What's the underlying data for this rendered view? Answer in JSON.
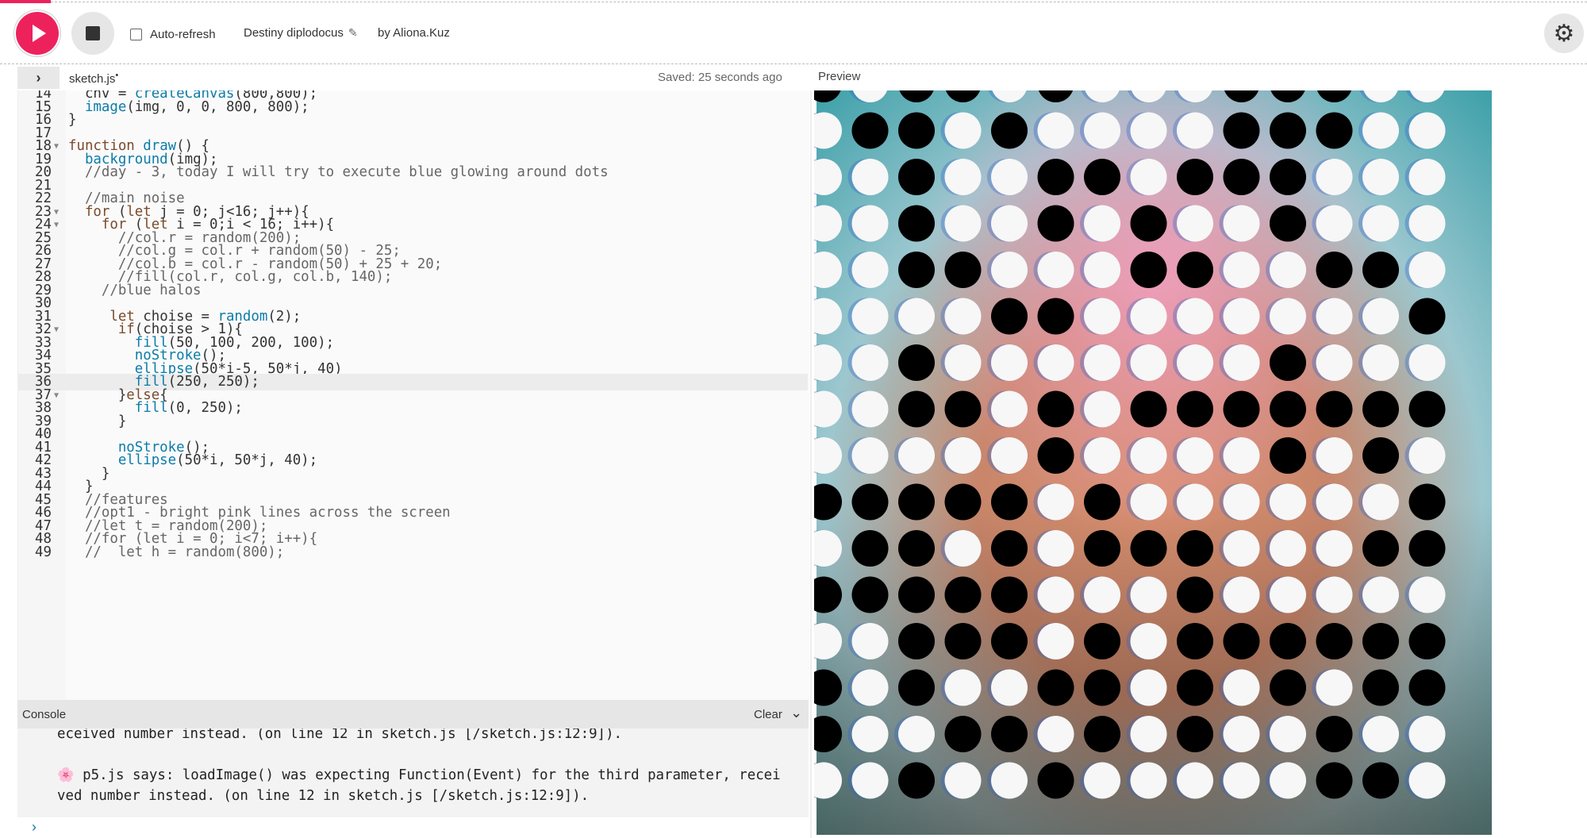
{
  "toolbar": {
    "auto_refresh_label": "Auto-refresh",
    "auto_refresh_checked": false,
    "sketch_name": "Destiny diplodocus",
    "author": "by Aliona.Kuz"
  },
  "editor": {
    "filename": "sketch.js",
    "unsaved_marker": "•",
    "saved_status": "Saved: 25 seconds ago",
    "active_line": 36,
    "lines": [
      {
        "n": 14,
        "fold": false,
        "code": "  cnv = createCanvas(800,800);"
      },
      {
        "n": 15,
        "fold": false,
        "code": "  image(img, 0, 0, 800, 800);"
      },
      {
        "n": 16,
        "fold": false,
        "code": "}"
      },
      {
        "n": 17,
        "fold": false,
        "code": ""
      },
      {
        "n": 18,
        "fold": true,
        "code": "function draw() {"
      },
      {
        "n": 19,
        "fold": false,
        "code": "  background(img);"
      },
      {
        "n": 20,
        "fold": false,
        "code": "  //day - 3, today I will try to execute blue glowing around dots"
      },
      {
        "n": 21,
        "fold": false,
        "code": ""
      },
      {
        "n": 22,
        "fold": false,
        "code": "  //main noise"
      },
      {
        "n": 23,
        "fold": true,
        "code": "  for (let j = 0; j<16; j++){"
      },
      {
        "n": 24,
        "fold": true,
        "code": "    for (let i = 0;i < 16; i++){"
      },
      {
        "n": 25,
        "fold": false,
        "code": "      //col.r = random(200);"
      },
      {
        "n": 26,
        "fold": false,
        "code": "      //col.g = col.r + random(50) - 25;"
      },
      {
        "n": 27,
        "fold": false,
        "code": "      //col.b = col.r - random(50) + 25 + 20;"
      },
      {
        "n": 28,
        "fold": false,
        "code": "      //fill(col.r, col.g, col.b, 140);"
      },
      {
        "n": 29,
        "fold": false,
        "code": "    //blue halos"
      },
      {
        "n": 30,
        "fold": false,
        "code": ""
      },
      {
        "n": 31,
        "fold": false,
        "code": "     let choise = random(2);"
      },
      {
        "n": 32,
        "fold": true,
        "code": "      if(choise > 1){"
      },
      {
        "n": 33,
        "fold": false,
        "code": "        fill(50, 100, 200, 100);"
      },
      {
        "n": 34,
        "fold": false,
        "code": "        noStroke();"
      },
      {
        "n": 35,
        "fold": false,
        "code": "        ellipse(50*i-5, 50*j, 40)"
      },
      {
        "n": 36,
        "fold": false,
        "code": "        fill(250, 250);"
      },
      {
        "n": 37,
        "fold": true,
        "code": "      }else{"
      },
      {
        "n": 38,
        "fold": false,
        "code": "        fill(0, 250);"
      },
      {
        "n": 39,
        "fold": false,
        "code": "      }"
      },
      {
        "n": 40,
        "fold": false,
        "code": ""
      },
      {
        "n": 41,
        "fold": false,
        "code": "      noStroke();"
      },
      {
        "n": 42,
        "fold": false,
        "code": "      ellipse(50*i, 50*j, 40);"
      },
      {
        "n": 43,
        "fold": false,
        "code": "    }"
      },
      {
        "n": 44,
        "fold": false,
        "code": "  }"
      },
      {
        "n": 45,
        "fold": false,
        "code": "  //features"
      },
      {
        "n": 46,
        "fold": false,
        "code": "  //opt1 - bright pink lines across the screen"
      },
      {
        "n": 47,
        "fold": false,
        "code": "  //let t = random(200);"
      },
      {
        "n": 48,
        "fold": false,
        "code": "  //for (let i = 0; i<7; i++){"
      },
      {
        "n": 49,
        "fold": false,
        "code": "  //  let h = random(800);"
      }
    ]
  },
  "console": {
    "title": "Console",
    "clear_label": "Clear",
    "messages": [
      "eceived number instead. (on line 12 in sketch.js [/sketch.js:12:9]).",
      "",
      "🌸 p5.js says: loadImage() was expecting Function(Event) for the third parameter, recei",
      "ved number instead. (on line 12 in sketch.js [/sketch.js:12:9])."
    ],
    "prompt": "›"
  },
  "preview": {
    "label": "Preview",
    "grid": [
      "BWBBWBWWWBBBW",
      "WBBWBWWWWBBBW",
      "WWBWWBBWBBBWW",
      "WWBWWBWBWWBWW",
      "WWBBWWWBBWWBBW",
      "WWWWBBWWWWWWWB",
      "WWBWWWWWWWBWWW",
      "WWBBWBWBBBBBBB",
      "WWWWWBWWWWBWBW",
      "BBBBBWBWWWWWWB",
      "WBBWBWBBBWWWBB",
      "BBBBBWWWBWWWWW",
      "WWBBBWBWBBBBBB",
      "BWBWWBBWBWBWBB",
      "BWWBBWBWBWWBWW",
      "WWBWWBWWWWWBBW"
    ]
  }
}
